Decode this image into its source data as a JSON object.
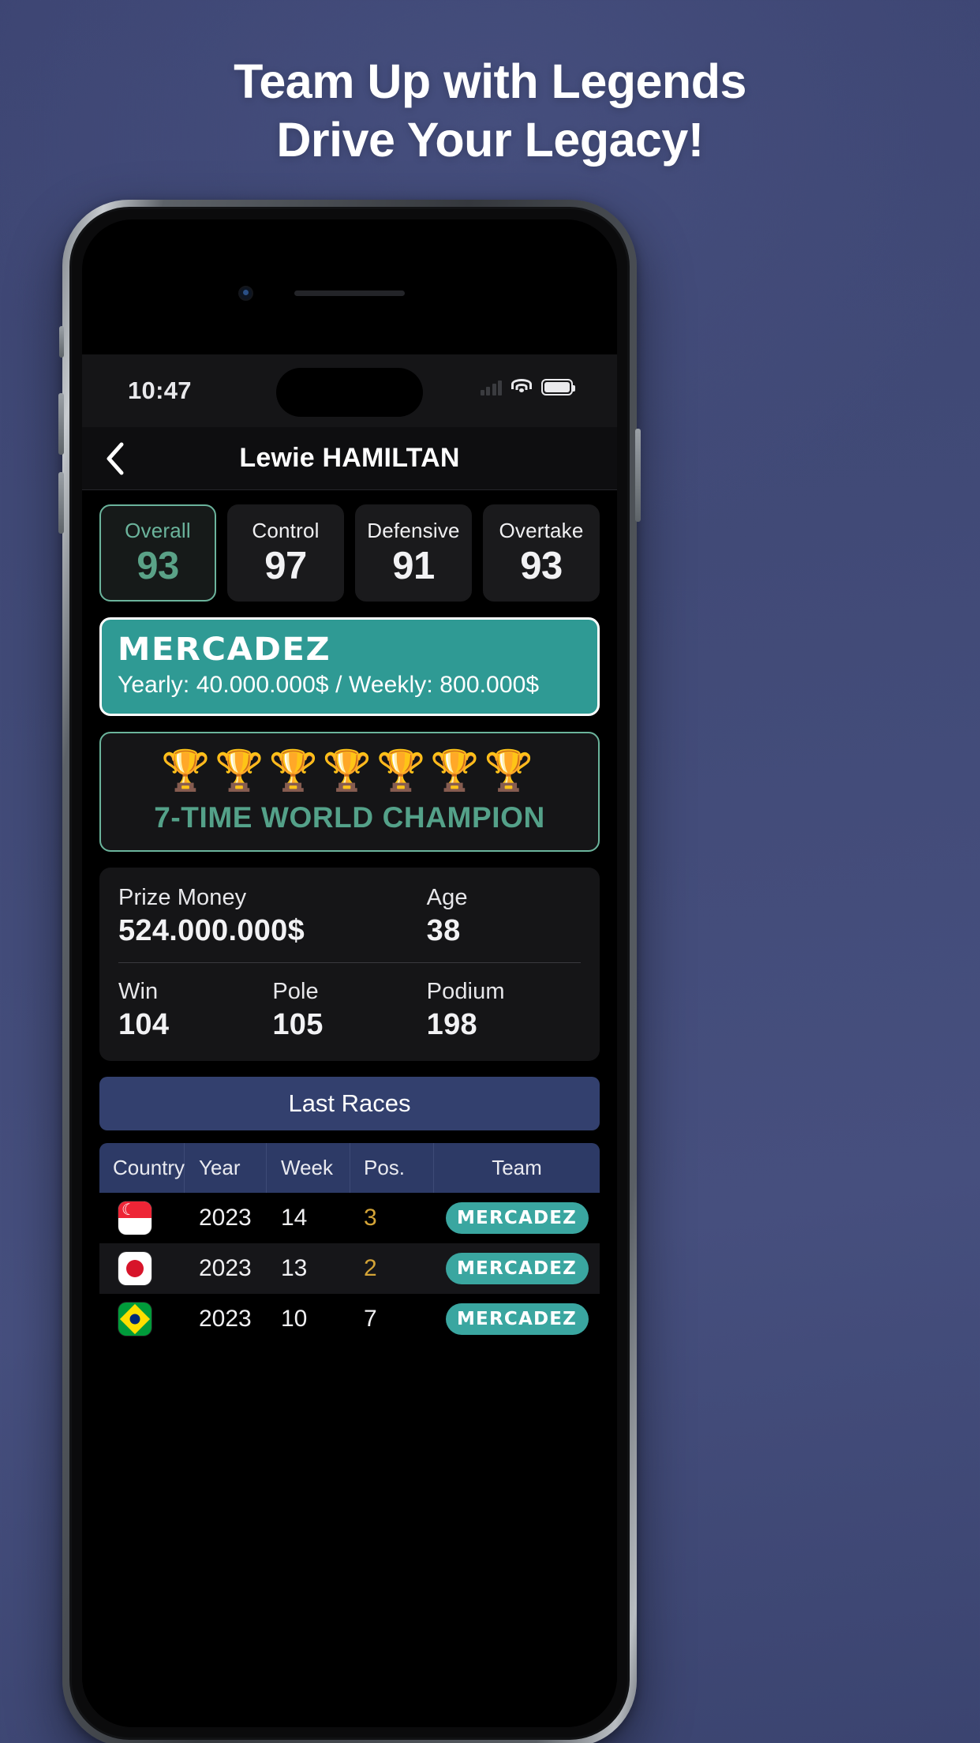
{
  "promo": {
    "line1": "Team Up with Legends",
    "line2": "Drive Your Legacy!"
  },
  "status_bar": {
    "time": "10:47",
    "cell_icon": "cellular-signal-icon",
    "wifi_icon": "wifi-icon",
    "battery_icon": "battery-icon"
  },
  "navbar": {
    "back_icon": "chevron-left-icon",
    "title": "Lewie HAMILTAN"
  },
  "stats": [
    {
      "label": "Overall",
      "value": "93",
      "accent": true
    },
    {
      "label": "Control",
      "value": "97",
      "accent": false
    },
    {
      "label": "Defensive",
      "value": "91",
      "accent": false
    },
    {
      "label": "Overtake",
      "value": "93",
      "accent": false
    }
  ],
  "team": {
    "name": "MERCADEZ",
    "salary": "Yearly: 40.000.000$ / Weekly: 800.000$"
  },
  "champion": {
    "trophies": "🏆🏆🏆🏆🏆🏆🏆",
    "trophy_icon": "trophy-icon",
    "text": "7-TIME WORLD CHAMPION"
  },
  "info": {
    "prize_money_label": "Prize Money",
    "prize_money_value": "524.000.000$",
    "age_label": "Age",
    "age_value": "38",
    "win_label": "Win",
    "win_value": "104",
    "pole_label": "Pole",
    "pole_value": "105",
    "podium_label": "Podium",
    "podium_value": "198"
  },
  "last_races": {
    "button_label": "Last Races",
    "columns": [
      "Country",
      "Year",
      "Week",
      "Pos.",
      "Team"
    ],
    "rows": [
      {
        "country_icon": "flag-singapore-icon",
        "flag": "sg",
        "year": "2023",
        "week": "14",
        "pos": "3",
        "pos_medal": true,
        "team": "MERCADEZ"
      },
      {
        "country_icon": "flag-japan-icon",
        "flag": "jp",
        "year": "2023",
        "week": "13",
        "pos": "2",
        "pos_medal": true,
        "team": "MERCADEZ"
      },
      {
        "country_icon": "flag-brazil-icon",
        "flag": "br",
        "year": "2023",
        "week": "10",
        "pos": "7",
        "pos_medal": false,
        "team": "MERCADEZ"
      }
    ]
  },
  "colors": {
    "accent_teal": "#3aa6a0",
    "accent_green": "#6bb49c",
    "nav_blue": "#2d3a66",
    "medal_gold": "#d4a437",
    "background": "#414a77"
  }
}
